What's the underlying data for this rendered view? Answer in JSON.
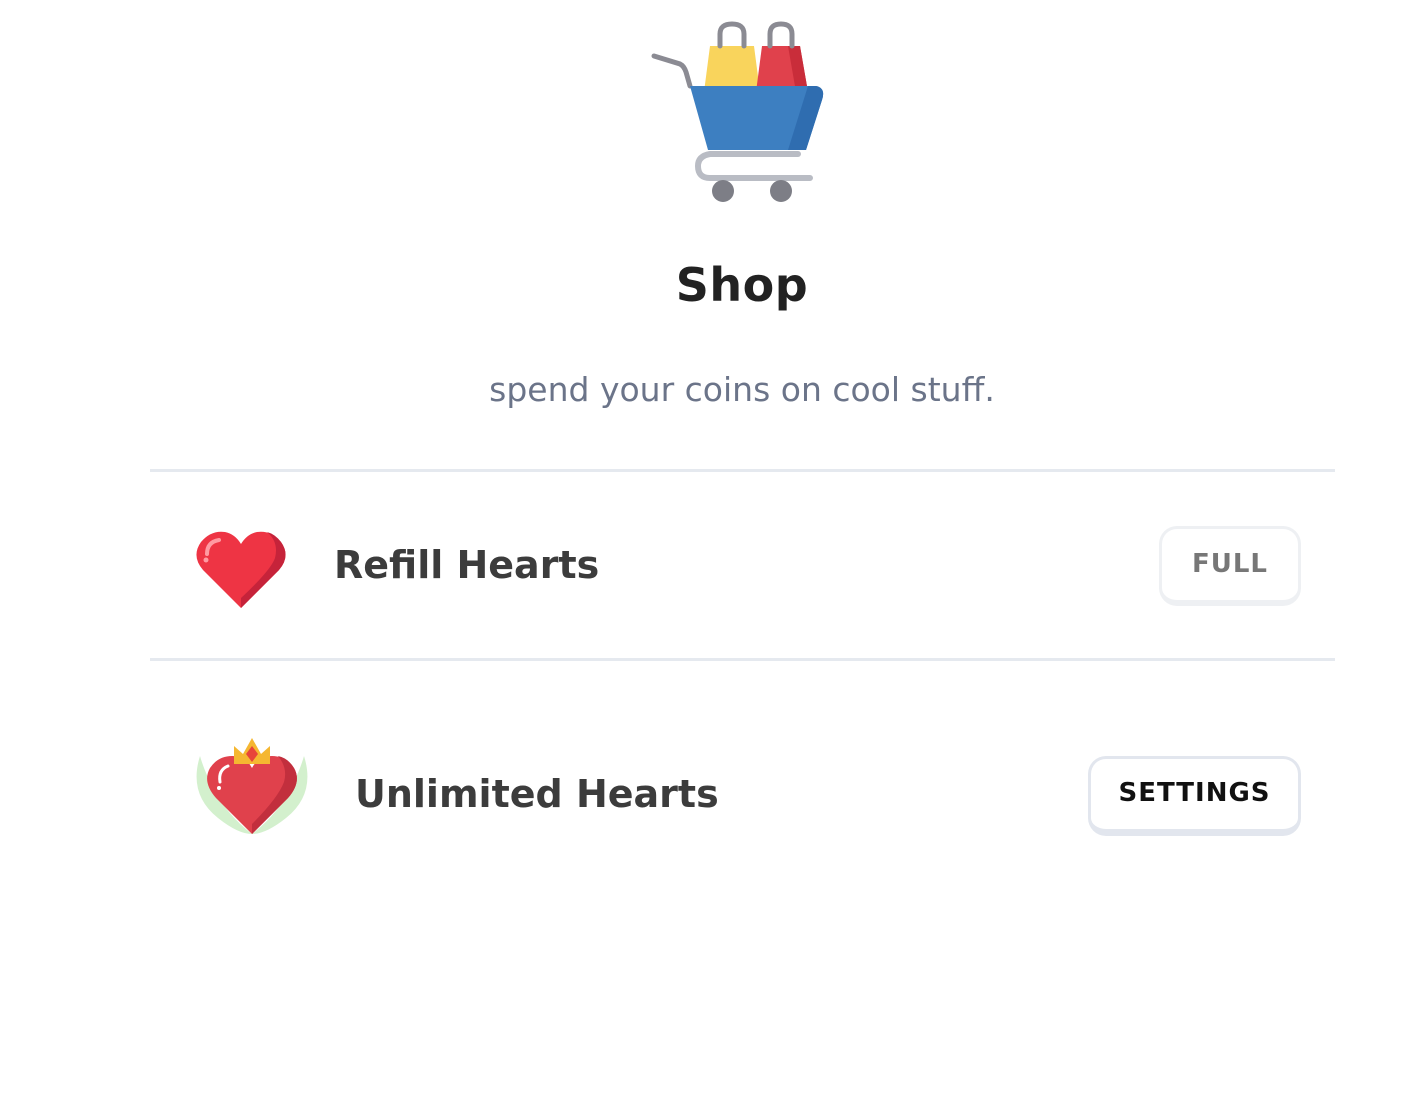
{
  "header": {
    "icon": "shopping-cart-icon",
    "title": "Shop",
    "subtitle": "spend your coins on cool stuff."
  },
  "items": [
    {
      "icon": "heart-icon",
      "label": "Refill Hearts",
      "button_label": "FULL"
    },
    {
      "icon": "crowned-heart-icon",
      "label": "Unlimited Hearts",
      "button_label": "SETTINGS"
    }
  ],
  "colors": {
    "cart_blue": "#3d7fc1",
    "bag_yellow": "#f9d45c",
    "bag_red": "#e0414c",
    "heart_red": "#ee3444",
    "crown_gold": "#f5b731",
    "leaf_green": "#d3f0cd",
    "divider": "#e5e9ef",
    "subtitle": "#6b7489"
  }
}
